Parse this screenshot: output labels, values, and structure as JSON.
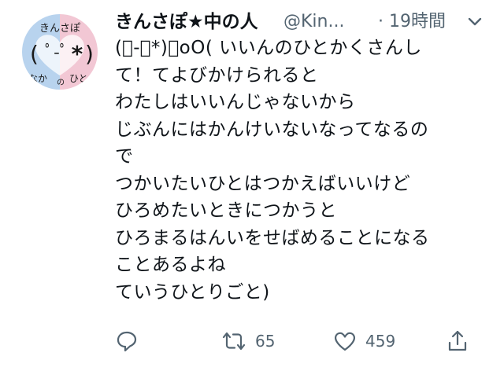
{
  "tweet": {
    "display_name": "きんさぽ★中の人",
    "handle": "@Kin...",
    "separator": "·",
    "time": "19時間",
    "lines": [
      "(ﾟ-ﾟ*)｡oO( いいんのひとかくさんし",
      "て！てよびかけられると",
      "わたしはいいんじゃないから",
      "じぶんにはかんけいないなってなるの",
      "で",
      "つかいたいひとはつかえばいいけど",
      "ひろめたいときにつかうと",
      "ひろまるはんいをせばめることになる",
      "ことあるよね",
      "ていうひとりごと)"
    ]
  },
  "avatar": {
    "text_top": "きんさぽ",
    "face": "ﾟ-ﾟ",
    "star": "*",
    "text_bottom_left": "なか",
    "text_bottom_mid": "の",
    "text_bottom_right": "ひと",
    "colors": {
      "left": "#b8d3ee",
      "right": "#f2c7d4",
      "heart": "#ffffff",
      "ink": "#1a1a1a"
    }
  },
  "actions": {
    "reply_icon": "reply-icon",
    "retweet_icon": "retweet-icon",
    "retweet_count": "65",
    "like_icon": "heart-icon",
    "like_count": "459",
    "share_icon": "share-icon"
  },
  "colors": {
    "text": "#0f1419",
    "secondary": "#536471"
  }
}
